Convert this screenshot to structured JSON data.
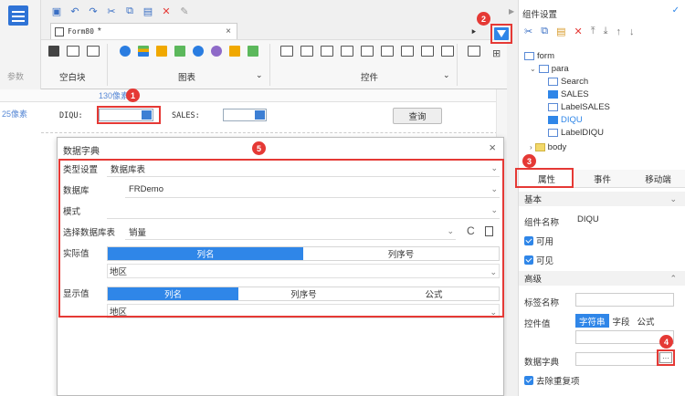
{
  "toolbar": {
    "tab_label": "Form80",
    "tab_modified": "*",
    "tab_close": "×",
    "ruler_mark": "130像素",
    "side_label": "25像素",
    "left_labels": [
      "参数"
    ],
    "groups": [
      {
        "label": "空白块"
      },
      {
        "label": "图表"
      },
      {
        "label": "控件"
      }
    ],
    "chevrons": [
      "⌄",
      "⌄"
    ]
  },
  "params": {
    "diqu_label": "DIQU:",
    "sales_label": "SALES:",
    "query_button": "查询"
  },
  "dialog": {
    "title": "数据字典",
    "close": "×",
    "type_label": "类型设置",
    "type_value": "数据库表",
    "db_label": "数据库",
    "db_value": "FRDemo",
    "mode_label": "模式",
    "mode_value": "",
    "table_label": "选择数据库表",
    "table_value": "销量",
    "actual_label": "实际值",
    "actual_seg": [
      "列名",
      "列序号"
    ],
    "actual_sub": "地区",
    "display_label": "显示值",
    "display_seg": [
      "列名",
      "列序号",
      "公式"
    ],
    "display_sub": "地区",
    "refresh_icon": "C",
    "chev": "⌄"
  },
  "panel": {
    "title": "组件设置",
    "tree": [
      {
        "label": "form"
      },
      {
        "label": "para"
      },
      {
        "label": "Search"
      },
      {
        "label": "SALES"
      },
      {
        "label": "LabelSALES"
      },
      {
        "label": "DIQU"
      },
      {
        "label": "LabelDIQU"
      },
      {
        "label": "body"
      }
    ],
    "tabs": [
      "属性",
      "事件",
      "移动端"
    ],
    "section_basic": "基本",
    "name_label": "组件名称",
    "name_value": "DIQU",
    "enabled_label": "可用",
    "visible_label": "可见",
    "section_advanced": "高级",
    "tag_label": "标签名称",
    "value_label": "控件值",
    "value_opts": [
      "字符串",
      "字段",
      "公式"
    ],
    "dict_label": "数据字典",
    "dict_btn": "···",
    "dedupe_label": "去除重复项"
  },
  "badges": [
    "1",
    "2",
    "3",
    "4",
    "5"
  ],
  "colors": {
    "accent": "#2f86e8",
    "annotation": "#e53935"
  }
}
